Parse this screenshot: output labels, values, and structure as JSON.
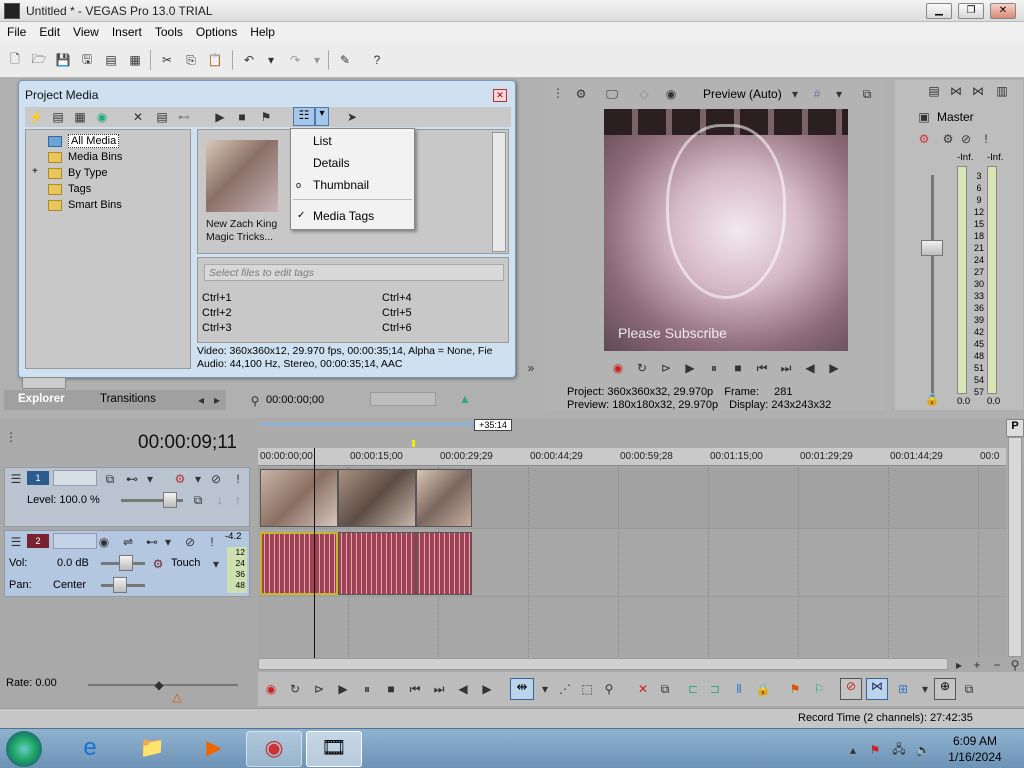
{
  "window": {
    "title": "Untitled * - VEGAS Pro 13.0 TRIAL",
    "min": "▁",
    "restore": "❐",
    "close": "✕"
  },
  "menu": [
    "File",
    "Edit",
    "View",
    "Insert",
    "Tools",
    "Options",
    "Help"
  ],
  "project_media": {
    "title": "Project Media",
    "tree": [
      "All Media",
      "Media Bins",
      "By Type",
      "Tags",
      "Smart Bins"
    ],
    "expand_glyph": "+",
    "file_caption": "New Zach King Magic Tricks...",
    "tags_placeholder": "Select files to edit tags",
    "shortcuts": [
      "Ctrl+1",
      "Ctrl+4",
      "Ctrl+2",
      "Ctrl+5",
      "Ctrl+3",
      "Ctrl+6"
    ],
    "info_video": "Video: 360x360x12, 29.970 fps, 00:00:35;14, Alpha = None, Fie",
    "info_audio": "Audio: 44,100 Hz, Stereo, 00:00:35;14, AAC"
  },
  "view_menu": {
    "items": [
      "List",
      "Details",
      "Thumbnail",
      "Media Tags"
    ],
    "radio": "o",
    "check": "✓"
  },
  "tabs": [
    "Explorer",
    "Transitions"
  ],
  "trim": {
    "time": "00:00:00;00"
  },
  "preview": {
    "mode": "Preview (Auto)",
    "watermark": "Please Subscribe",
    "info_project_label": "Project:",
    "info_project": "360x360x32, 29.970p",
    "info_frame_label": "Frame:",
    "info_frame": "281",
    "info_preview_label": "Preview:",
    "info_preview": "180x180x32, 29.970p",
    "info_display_label": "Display:",
    "info_display": "243x243x32"
  },
  "master": {
    "name": "Master",
    "peak_l": "-Inf.",
    "peak_r": "-Inf.",
    "scale": [
      "3",
      "6",
      "9",
      "12",
      "15",
      "18",
      "21",
      "24",
      "27",
      "30",
      "33",
      "36",
      "39",
      "42",
      "45",
      "48",
      "51",
      "54",
      "57"
    ],
    "val_l": "0.0",
    "val_r": "0.0"
  },
  "timeline": {
    "current_time": "00:00:09;11",
    "marker": "+35:14",
    "ticks": [
      "00:00:00;00",
      "00:00:15;00",
      "00:00:29;29",
      "00:00:44;29",
      "00:00:59;28",
      "00:01:15;00",
      "00:01:29;29",
      "00:01:44;29",
      "00:0"
    ],
    "track1": {
      "num": "1",
      "level": "Level: 100.0 %"
    },
    "track2": {
      "num": "2",
      "vol_label": "Vol:",
      "vol": "0.0 dB",
      "pan_label": "Pan:",
      "pan": "Center",
      "mode": "Touch",
      "meter_top": "-4.2",
      "meter_scale": [
        "12",
        "24",
        "36",
        "48"
      ]
    }
  },
  "transport": {
    "rate": "Rate: 0.00"
  },
  "status": {
    "record_time": "Record Time (2 channels): 27:42:35"
  },
  "taskbar": {
    "time": "6:09 AM",
    "date": "1/16/2024"
  }
}
